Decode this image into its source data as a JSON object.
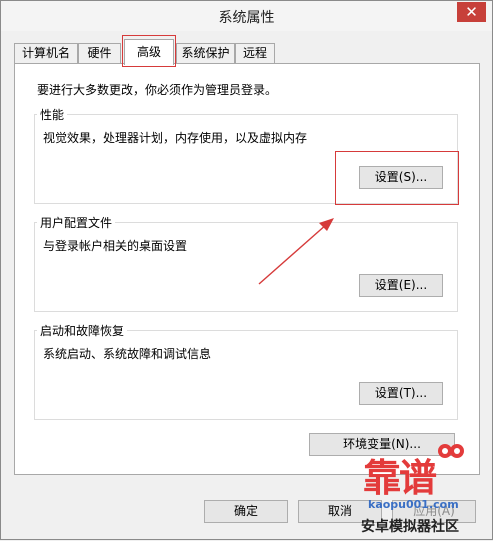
{
  "window": {
    "title": "系统属性",
    "close_glyph": "✕"
  },
  "tabs": [
    {
      "label": "计算机名"
    },
    {
      "label": "硬件"
    },
    {
      "label": "高级"
    },
    {
      "label": "系统保护"
    },
    {
      "label": "远程"
    }
  ],
  "admin_note": "要进行大多数更改，你必须作为管理员登录。",
  "groups": {
    "performance": {
      "title": "性能",
      "desc": "视觉效果，处理器计划，内存使用，以及虚拟内存",
      "button": "设置(S)..."
    },
    "user_profiles": {
      "title": "用户配置文件",
      "desc": "与登录帐户相关的桌面设置",
      "button": "设置(E)..."
    },
    "startup": {
      "title": "启动和故障恢复",
      "desc": "系统启动、系统故障和调试信息",
      "button": "设置(T)..."
    }
  },
  "env_button": "环境变量(N)...",
  "footer": {
    "ok": "确定",
    "cancel": "取消",
    "apply": "应用(A)"
  },
  "watermark": {
    "brand": "靠谱",
    "domain": "kaopu001.com",
    "subtitle": "安卓模拟器社区"
  },
  "colors": {
    "highlight": "#d63a3a",
    "close_bg": "#c7403a"
  }
}
